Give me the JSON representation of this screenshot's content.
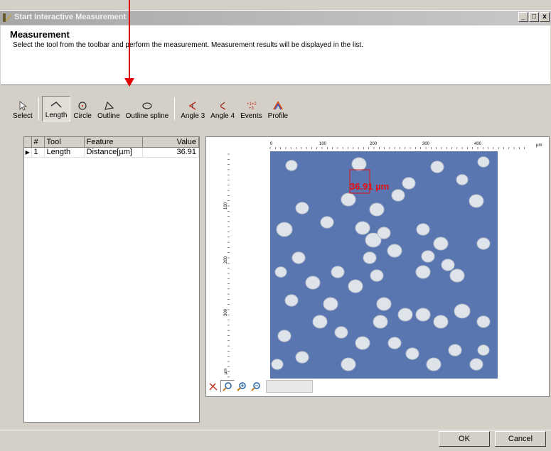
{
  "window": {
    "title": "Start Interactive Measurement",
    "min": "_",
    "max": "□",
    "close": "x"
  },
  "header": {
    "title": "Measurement",
    "instructions": "Select the tool from the toolbar and perform the measurement. Measurement results will be displayed in the list."
  },
  "toolbar": {
    "items": [
      {
        "label": "Select",
        "icon": "select-cursor-icon",
        "pressed": false
      },
      {
        "label": "Length",
        "icon": "length-line-icon",
        "pressed": true
      },
      {
        "label": "Circle",
        "icon": "circle-icon",
        "pressed": false
      },
      {
        "label": "Outline",
        "icon": "outline-polygon-icon",
        "pressed": false
      },
      {
        "label": "Outline spline",
        "icon": "outline-spline-icon",
        "pressed": false
      },
      {
        "label": "Angle 3",
        "icon": "angle3-icon",
        "pressed": false
      },
      {
        "label": "Angle 4",
        "icon": "angle4-icon",
        "pressed": false
      },
      {
        "label": "Events",
        "icon": "events-icon",
        "pressed": false
      },
      {
        "label": "Profile",
        "icon": "profile-icon",
        "pressed": false
      }
    ]
  },
  "results": {
    "columns": [
      "#",
      "Tool",
      "Feature",
      "Value"
    ],
    "rows": [
      {
        "index": "1",
        "tool": "Length",
        "feature": "Distance[µm]",
        "value": "36.91"
      }
    ]
  },
  "image": {
    "measurement_label": "36.91 µm",
    "ruler_top_ticks": [
      "0",
      "100",
      "200",
      "300",
      "400"
    ],
    "ruler_top_unit": "µm",
    "ruler_left_ticks": [
      "100",
      "200",
      "300"
    ],
    "ruler_left_unit": "µm",
    "background_color": "#5a76b0",
    "measure_color": "#e01010"
  },
  "footer": {
    "ok_label": "OK",
    "cancel_label": "Cancel"
  },
  "annotation_color": "#e00000"
}
